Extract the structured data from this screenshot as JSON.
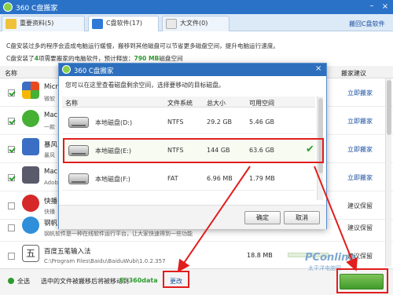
{
  "app": {
    "title": "360 C盘搬家"
  },
  "tabs": [
    {
      "label": "重要资料(5)"
    },
    {
      "label": "C盘软件(17)"
    },
    {
      "label": "大文件(0)"
    }
  ],
  "header": {
    "back_link": "搬回C盘软件"
  },
  "info": {
    "line1": "C盘安装过多的程序会造成电脑运行缓慢，搬移到其他磁盘可以节省更多磁盘空间，提升电脑运行速度。",
    "line2_prefix": "C盘安装了",
    "line2_count": "4",
    "line2_mid": "项需要搬家的电脑软件，预计释放：",
    "line2_size": "790 MB",
    "line2_suffix": "磁盘空间"
  },
  "columns": {
    "name": "名称",
    "suggestion": "搬家建议"
  },
  "rows": [
    {
      "name": "Micr",
      "sub": "微软",
      "size": "",
      "action": "立即搬家",
      "checked": true,
      "color": "#e84a1e"
    },
    {
      "name": "Macr",
      "sub": "一款",
      "size": "",
      "action": "立即搬家",
      "checked": true,
      "color": "#46b035"
    },
    {
      "name": "暴风",
      "sub": "暴风",
      "size": "",
      "action": "立即搬家",
      "checked": true,
      "color": "#3a6fc4"
    },
    {
      "name": "Macr",
      "sub": "Adob",
      "size": "",
      "action": "立即搬家",
      "checked": true,
      "color": "#5a5a6a"
    },
    {
      "name": "快播",
      "sub": "快播",
      "size": "",
      "action": "建议保留",
      "checked": false,
      "color": "#d62828"
    },
    {
      "name": "钢帆",
      "sub": "钢帆软件是一种在线软件运行平台，让大家快速得到一些功能",
      "size": "",
      "action": "建议保留",
      "checked": false,
      "color": "#2f8fd8"
    },
    {
      "name": "百度五笔输入法",
      "sub": "C:\\Program Files\\Baidu\\BaiduWubi\\1.0.2.357",
      "size": "18.8 MB",
      "action": "建议保留",
      "checked": false,
      "color": "#333333"
    }
  ],
  "bottom": {
    "select_all": "全选",
    "move_text": "选中的文件被搬移后将被移动到",
    "move_path": "E:\\360data",
    "change_link": "更改",
    "watermark": "PConline",
    "watermark_sub": "太平洋电脑网"
  },
  "dialog": {
    "title": "360 C盘搬家",
    "subtitle": "您可以在这里查看磁盘剩余空间，选择要移动的目标磁盘。",
    "columns": {
      "name": "名称",
      "fs": "文件系统",
      "total": "总大小",
      "free": "可用空间"
    },
    "drives": [
      {
        "name": "本地磁盘(D:)",
        "fs": "NTFS",
        "total": "29.2 GB",
        "free": "5.46 GB",
        "selected": false
      },
      {
        "name": "本地磁盘(E:)",
        "fs": "NTFS",
        "total": "144 GB",
        "free": "63.6 GB",
        "selected": true
      },
      {
        "name": "本地磁盘(F:)",
        "fs": "FAT",
        "total": "6.96 MB",
        "free": "1.79 MB",
        "selected": false
      }
    ],
    "ok": "确定",
    "cancel": "取消"
  },
  "colors": {
    "titlebar": "#2a72c8",
    "accent_green": "#2e9a2e",
    "annotation_red": "#e21d1d",
    "dialog_title": "#2d6fbd"
  }
}
